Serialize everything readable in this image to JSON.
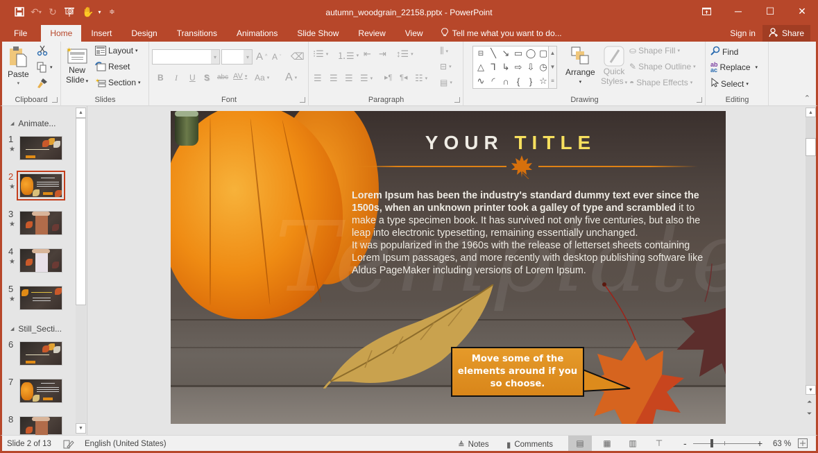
{
  "app": {
    "window_title": "autumn_woodgrain_22158.pptx - PowerPoint",
    "accent": "#b7472a"
  },
  "qat": {
    "icons": [
      "save-icon",
      "undo-icon",
      "redo-icon",
      "start-from-beginning-icon",
      "touch-mode-icon",
      "customize-qat-icon"
    ]
  },
  "window_controls": [
    "ribbon-display-options-icon",
    "minimize-icon",
    "maximize-icon",
    "close-icon"
  ],
  "tabs": [
    {
      "label": "File"
    },
    {
      "label": "Home",
      "active": true
    },
    {
      "label": "Insert"
    },
    {
      "label": "Design"
    },
    {
      "label": "Transitions"
    },
    {
      "label": "Animations"
    },
    {
      "label": "Slide Show"
    },
    {
      "label": "Review"
    },
    {
      "label": "View"
    }
  ],
  "tell_me": "Tell me what you want to do...",
  "sign_in": "Sign in",
  "share": "Share",
  "ribbon": {
    "clipboard": {
      "label": "Clipboard",
      "paste": "Paste"
    },
    "slides": {
      "label": "Slides",
      "new_slide_1": "New",
      "new_slide_2": "Slide",
      "layout": "Layout",
      "reset": "Reset",
      "section": "Section"
    },
    "font": {
      "label": "Font",
      "font_name": "",
      "font_size": "",
      "bold": "B",
      "italic": "I",
      "underline": "U",
      "shadow": "S",
      "strike": "abc",
      "spacing": "AV",
      "case": "Aa",
      "color": "A"
    },
    "paragraph": {
      "label": "Paragraph"
    },
    "drawing": {
      "label": "Drawing",
      "arrange": "Arrange",
      "quick_styles_1": "Quick",
      "quick_styles_2": "Styles",
      "shape_fill": "Shape Fill",
      "shape_outline": "Shape Outline",
      "shape_effects": "Shape Effects"
    },
    "editing": {
      "label": "Editing",
      "find": "Find",
      "replace": "Replace",
      "select": "Select"
    }
  },
  "thumbnails": {
    "sections": [
      {
        "name": "Animate...",
        "slides": [
          1,
          2,
          3,
          4,
          5
        ]
      },
      {
        "name": "Still_Secti...",
        "slides": [
          6,
          7,
          8
        ]
      }
    ],
    "slides": [
      {
        "num": "1",
        "star": true
      },
      {
        "num": "2",
        "star": true,
        "active": true
      },
      {
        "num": "3",
        "star": true
      },
      {
        "num": "4",
        "star": true
      },
      {
        "num": "5",
        "star": true
      },
      {
        "num": "6",
        "star": false
      },
      {
        "num": "7",
        "star": false
      },
      {
        "num": "8",
        "star": false
      }
    ]
  },
  "slide": {
    "title_white": "YOUR",
    "title_yellow": "TITLE",
    "body_bold": "Lorem Ipsum has been the industry's standard dummy text ever since the 1500s, when an unknown printer took a galley of type and scrambled",
    "body_regular_1": " it to make a type specimen book. It has survived not only five centuries, but also the leap into electronic typesetting, remaining essentially unchanged.",
    "body_regular_2": "It was popularized in the 1960s with the release of letterset sheets containing Lorem Ipsum passages, and more recently with desktop publishing software like Aldus PageMaker including versions of Lorem Ipsum.",
    "callout": "Move some of the elements around if you so choose.",
    "colors": {
      "title_white": "#efece4",
      "title_yellow": "#f7e05e",
      "divider": "#e08214",
      "callout_fill": "#e0921f"
    }
  },
  "status": {
    "slide_info": "Slide 2 of 13",
    "language": "English (United States)",
    "notes": "Notes",
    "comments": "Comments",
    "zoom": "63 %",
    "zoom_percent": 63
  }
}
